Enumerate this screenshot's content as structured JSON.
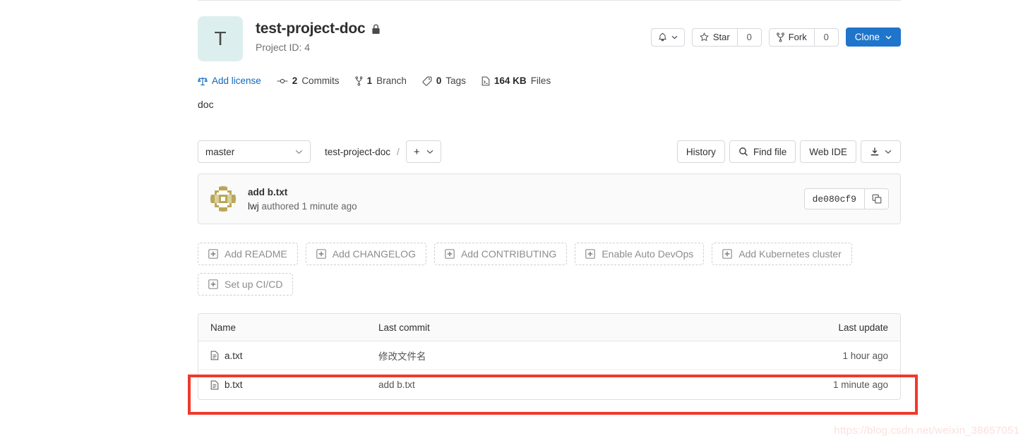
{
  "project": {
    "avatar_letter": "T",
    "name": "test-project-doc",
    "visibility_icon": "lock-icon",
    "project_id_label": "Project ID: 4",
    "description": "doc"
  },
  "header_actions": {
    "notifications_icon": "bell-icon",
    "notifications_caret_icon": "chevron-down-icon",
    "star_icon": "star-icon",
    "star_label": "Star",
    "star_count": "0",
    "fork_icon": "fork-icon",
    "fork_label": "Fork",
    "fork_count": "0",
    "clone_label": "Clone",
    "clone_caret_icon": "chevron-down-icon",
    "clone_color": "#1f75cb"
  },
  "stats": [
    {
      "icon": "scale-icon",
      "value": "",
      "label": "Add license",
      "link": true
    },
    {
      "icon": "commit-icon",
      "value": "2",
      "label": "Commits",
      "link": false
    },
    {
      "icon": "branch-icon",
      "value": "1",
      "label": "Branch",
      "link": false
    },
    {
      "icon": "tag-icon",
      "value": "0",
      "label": "Tags",
      "link": false
    },
    {
      "icon": "doc-icon",
      "value": "164 KB",
      "label": "Files",
      "link": false
    }
  ],
  "repo_bar": {
    "branch_value": "master",
    "branch_caret_icon": "chevron-down-icon",
    "breadcrumb_root": "test-project-doc",
    "breadcrumb_separator": "/",
    "plus_label": "+",
    "plus_caret_icon": "chevron-down-icon",
    "history_label": "History",
    "find_file_icon": "search-icon",
    "find_file_label": "Find file",
    "web_ide_label": "Web IDE",
    "download_icon": "download-icon",
    "download_caret_icon": "chevron-down-icon"
  },
  "last_commit": {
    "avatar_icon": "identicon-avatar",
    "title": "add b.txt",
    "author": "lwj",
    "authored_text": "authored 1 minute ago",
    "sha": "de080cf9",
    "copy_icon": "copy-icon"
  },
  "add_buttons": [
    {
      "icon": "plus-square-icon",
      "label": "Add README"
    },
    {
      "icon": "plus-square-icon",
      "label": "Add CHANGELOG"
    },
    {
      "icon": "plus-square-icon",
      "label": "Add CONTRIBUTING"
    },
    {
      "icon": "plus-square-icon",
      "label": "Enable Auto DevOps"
    },
    {
      "icon": "plus-square-icon",
      "label": "Add Kubernetes cluster"
    },
    {
      "icon": "plus-square-icon",
      "label": "Set up CI/CD"
    }
  ],
  "files_table": {
    "columns": [
      "Name",
      "Last commit",
      "Last update"
    ],
    "rows": [
      {
        "icon": "file-icon",
        "name": "a.txt",
        "last_commit": "修改文件名",
        "last_update": "1 hour ago"
      },
      {
        "icon": "file-icon",
        "name": "b.txt",
        "last_commit": "add b.txt",
        "last_update": "1 minute ago"
      }
    ]
  },
  "annotation": {
    "color": "#f0392b",
    "target_row_index": 1
  },
  "watermark": {
    "text": "https://blog.csdn.net/weixin_38657051"
  }
}
